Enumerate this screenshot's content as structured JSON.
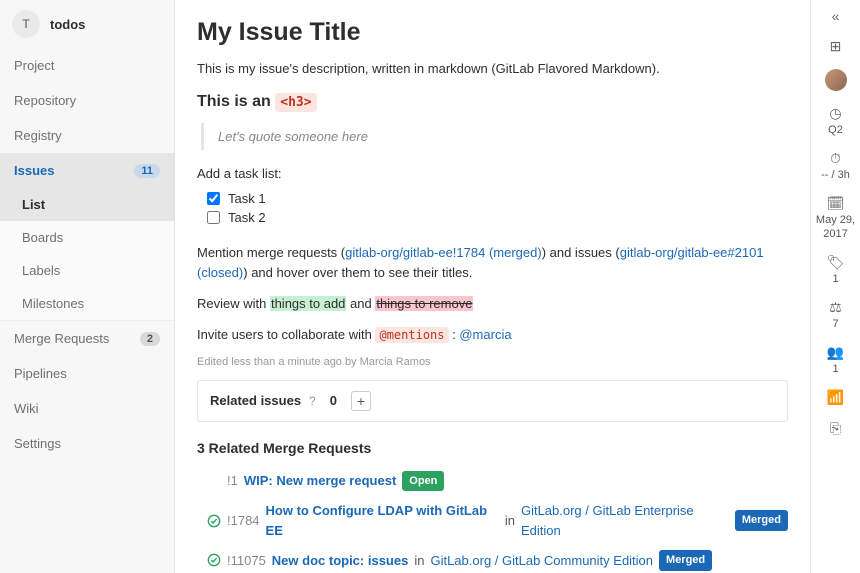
{
  "project": {
    "avatar_letter": "T",
    "name": "todos"
  },
  "sidebar": {
    "items": [
      {
        "label": "Project"
      },
      {
        "label": "Repository"
      },
      {
        "label": "Registry"
      },
      {
        "label": "Issues",
        "count": "11"
      },
      {
        "label": "Merge Requests",
        "count": "2"
      },
      {
        "label": "Pipelines"
      },
      {
        "label": "Wiki"
      },
      {
        "label": "Settings"
      }
    ],
    "issues_sub": [
      {
        "label": "List"
      },
      {
        "label": "Boards"
      },
      {
        "label": "Labels"
      },
      {
        "label": "Milestones"
      }
    ]
  },
  "issue": {
    "title": "My Issue Title",
    "description": "This is my issue's description, written in markdown (GitLab Flavored Markdown).",
    "h3_prefix": "This is an ",
    "h3_tag": "<h3>",
    "quote": "Let's quote someone here",
    "task_intro": "Add a task list:",
    "tasks": [
      {
        "label": "Task 1",
        "checked": true
      },
      {
        "label": "Task 2",
        "checked": false
      }
    ],
    "mention_p1": "Mention merge requests (",
    "mr_ref": "gitlab-org/gitlab-ee!1784 (merged)",
    "mention_p2": ") and issues (",
    "issue_ref": "gitlab-org/gitlab-ee#2101 (closed)",
    "mention_p3": ") and hover over them to see their titles.",
    "review_prefix": "Review with ",
    "add_text": "things to add",
    "review_mid": " and ",
    "remove_text": "things to remove",
    "invite_prefix": "Invite users to collaborate with ",
    "mentions_tag": "@mentions",
    "invite_mid": " : ",
    "invite_user": "@marcia",
    "edited_meta": "Edited less than a minute ago by Marcia Ramos"
  },
  "related_issues": {
    "title": "Related issues",
    "count": "0"
  },
  "related_mrs": {
    "title": "3 Related Merge Requests",
    "rows": [
      {
        "id": "!1",
        "title": "WIP: New merge request",
        "status": "Open",
        "status_class": "open",
        "has_check": false,
        "path": ""
      },
      {
        "id": "!1784",
        "title": "How to Configure LDAP with GitLab EE",
        "in": "in",
        "path": "GitLab.org / GitLab Enterprise Edition",
        "status": "Merged",
        "status_class": "merged",
        "has_check": true
      },
      {
        "id": "!11075",
        "title": "New doc topic: issues",
        "in": "in",
        "path": "GitLab.org / GitLab Community Edition",
        "status": "Merged",
        "status_class": "merged",
        "has_check": true
      }
    ]
  },
  "right": {
    "milestone": "Q2",
    "time": "-- / 3h",
    "date_line1": "May 29,",
    "date_line2": "2017",
    "labels": "1",
    "weight": "7",
    "participants": "1"
  }
}
